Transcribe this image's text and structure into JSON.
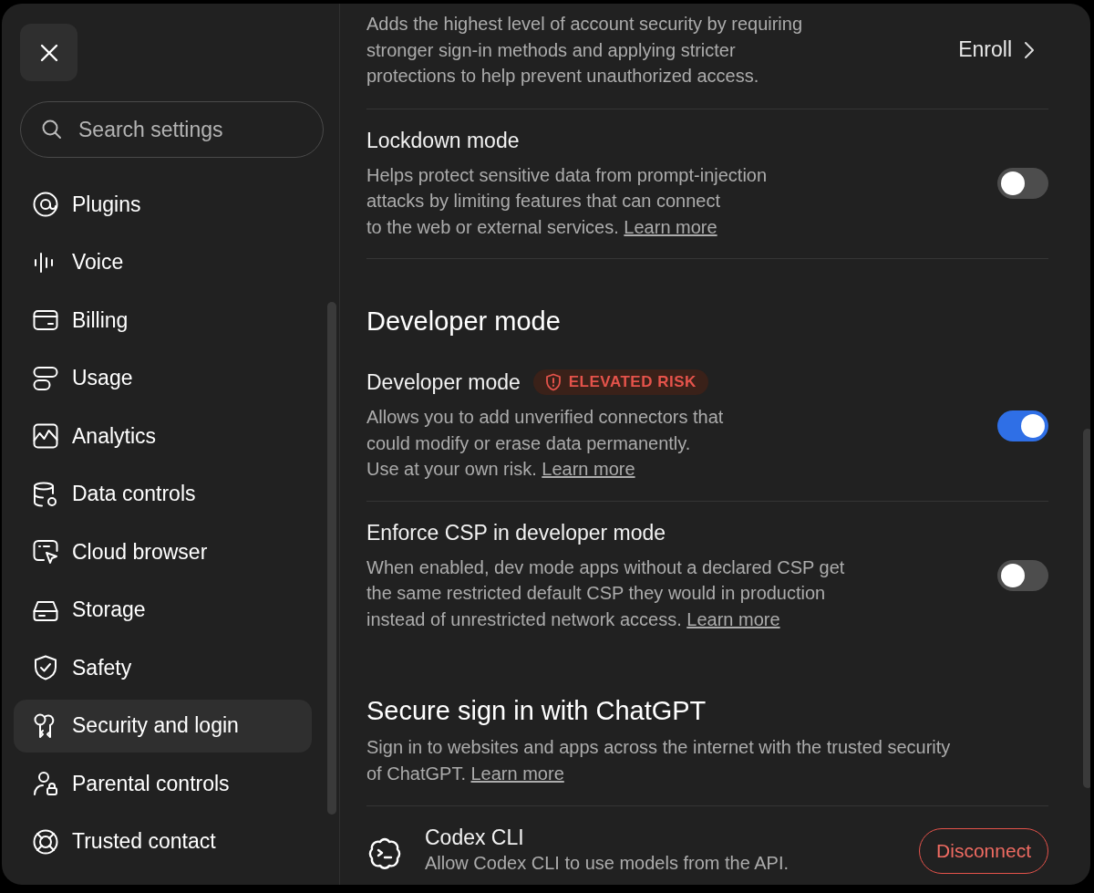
{
  "sidebar": {
    "search": {
      "placeholder": "Search settings"
    },
    "items": [
      {
        "label": "Plugins",
        "selected": false
      },
      {
        "label": "Voice",
        "selected": false
      },
      {
        "label": "Billing",
        "selected": false
      },
      {
        "label": "Usage",
        "selected": false
      },
      {
        "label": "Analytics",
        "selected": false
      },
      {
        "label": "Data controls",
        "selected": false
      },
      {
        "label": "Cloud browser",
        "selected": false
      },
      {
        "label": "Storage",
        "selected": false
      },
      {
        "label": "Safety",
        "selected": false
      },
      {
        "label": "Security and login",
        "selected": true
      },
      {
        "label": "Parental controls",
        "selected": false
      },
      {
        "label": "Trusted contact",
        "selected": false
      }
    ]
  },
  "sections": [
    {
      "kind": "enroll",
      "description": "Adds the highest level of account security by requiring\nstronger sign-in methods and applying stricter\nprotections to help prevent unauthorized access.",
      "action": "Enroll"
    },
    {
      "kind": "divider"
    },
    {
      "kind": "toggle",
      "title": "Lockdown mode",
      "description": "Helps protect sensitive data from prompt-injection\nattacks by limiting features that can connect\nto the web or external services.",
      "link": "Learn more",
      "on": false
    },
    {
      "kind": "divider"
    },
    {
      "kind": "heading",
      "title": "Developer mode"
    },
    {
      "kind": "toggle",
      "title": "Developer mode",
      "badge": "ELEVATED RISK",
      "description": "Allows you to add unverified connectors that\ncould modify or erase data permanently.\nUse at your own risk.",
      "link": "Learn more",
      "on": true
    },
    {
      "kind": "divider"
    },
    {
      "kind": "toggle",
      "title": "Enforce CSP in developer mode",
      "description": "When enabled, dev mode apps without a declared CSP get\nthe same restricted default CSP they would in production\ninstead of unrestricted network access.",
      "link": "Learn more",
      "on": false
    },
    {
      "kind": "heading",
      "title": "Secure sign in with ChatGPT",
      "description": "Sign in to websites and apps across the internet with the trusted security\nof ChatGPT.",
      "link": "Learn more"
    },
    {
      "kind": "divider"
    },
    {
      "kind": "app",
      "title": "Codex CLI",
      "description": "Allow Codex CLI to use models from the API.",
      "button": "Disconnect"
    }
  ]
}
